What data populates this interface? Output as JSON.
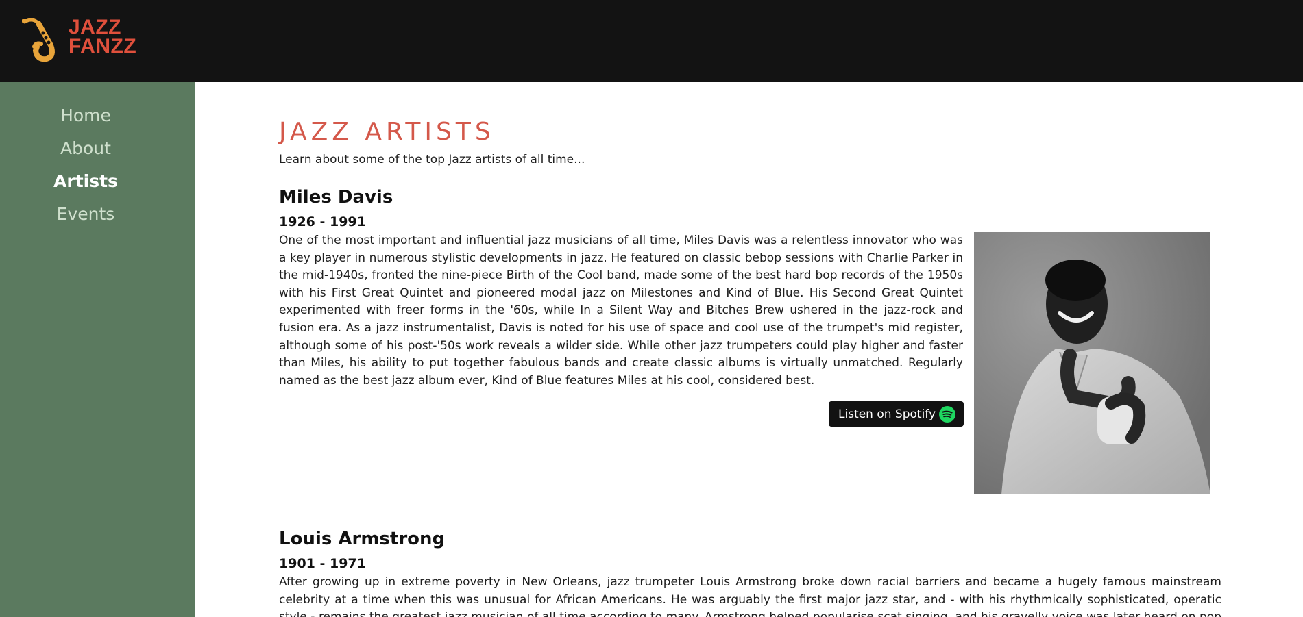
{
  "header": {
    "logo": {
      "line1": "JAZZ",
      "line2": "FANZZ",
      "icon": "saxophone-icon",
      "color": "#e0503c"
    }
  },
  "sidebar": {
    "items": [
      {
        "label": "Home",
        "active": false
      },
      {
        "label": "About",
        "active": false
      },
      {
        "label": "Artists",
        "active": true
      },
      {
        "label": "Events",
        "active": false
      }
    ]
  },
  "main": {
    "title": "JAZZ ARTISTS",
    "subtitle": "Learn about some of the top Jazz artists of all time...",
    "artists": [
      {
        "name": "Miles Davis",
        "years": "1926 - 1991",
        "bio": "One of the most important and influential jazz musicians of all time, Miles Davis was a relentless innovator who was a key player in numerous stylistic developments in jazz. He featured on classic bebop sessions with Charlie Parker in the mid-1940s, fronted the nine-piece Birth of the Cool band, made some of the best hard bop records of the 1950s with his First Great Quintet and pioneered modal jazz on Milestones and Kind of Blue. His Second Great Quintet experimented with freer forms in the '60s, while In a Silent Way and Bitches Brew ushered in the jazz-rock and fusion era. As a jazz instrumentalist, Davis is noted for his use of space and cool use of the trumpet's mid register, although some of his post-'50s work reveals a wilder side. While other jazz trumpeters could play higher and faster than Miles, his ability to put together fabulous bands and create classic albums is virtually unmatched. Regularly named as the best jazz album ever, Kind of Blue features Miles at his cool, considered best.",
        "spotify_label": "Listen on Spotify"
      },
      {
        "name": "Louis Armstrong",
        "years": "1901 - 1971",
        "bio": "After growing up in extreme poverty in New Orleans, jazz trumpeter Louis Armstrong broke down racial barriers and became a hugely famous mainstream celebrity at a time when this was unusual for African Americans. He was arguably the first major jazz star, and - with his rhythmically sophisticated, operatic style - remains the greatest jazz musician of all time according to many. Armstrong helped popularise scat singing, and his gravelly voice was later heard on pop hits like ' What a Wonderful"
      }
    ]
  },
  "colors": {
    "topbar": "#131313",
    "sidebar": "#5b7a5f",
    "title": "#d4584a",
    "spotify_green": "#1ed760"
  }
}
